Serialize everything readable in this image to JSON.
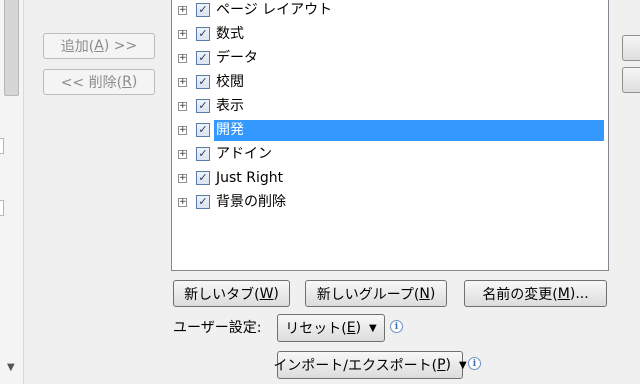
{
  "transfer": {
    "add_label": "追加(",
    "add_key": "A",
    "add_suffix": ") >>",
    "remove_prefix": "<< 削除(",
    "remove_key": "R",
    "remove_suffix": ")"
  },
  "tree": {
    "items": [
      {
        "label": "ページ レイアウト",
        "checked": true
      },
      {
        "label": "数式",
        "checked": true
      },
      {
        "label": "データ",
        "checked": true
      },
      {
        "label": "校閲",
        "checked": true
      },
      {
        "label": "表示",
        "checked": true
      },
      {
        "label": "開発",
        "checked": true,
        "selected": true
      },
      {
        "label": "アドイン",
        "checked": true
      },
      {
        "label": "Just Right",
        "checked": true
      },
      {
        "label": "背景の削除",
        "checked": true
      }
    ],
    "expander_glyph": "+",
    "check_glyph": "✓"
  },
  "buttons": {
    "new_tab": {
      "text": "新しいタブ(",
      "key": "W",
      "end": ")"
    },
    "new_group": {
      "text": "新しいグループ(",
      "key": "N",
      "end": ")"
    },
    "rename": {
      "text": "名前の変更(",
      "key": "M",
      "end": ")..."
    }
  },
  "customize": {
    "label": "ユーザー設定:",
    "reset": {
      "text": "リセット(",
      "key": "E",
      "end": ")"
    },
    "import_export": {
      "text": "インポート/エクスポート(",
      "key": "P",
      "end": ")"
    },
    "dropdown_glyph": "▼",
    "info_glyph": "i"
  },
  "scroll": {
    "arrow_glyph": "▼"
  }
}
